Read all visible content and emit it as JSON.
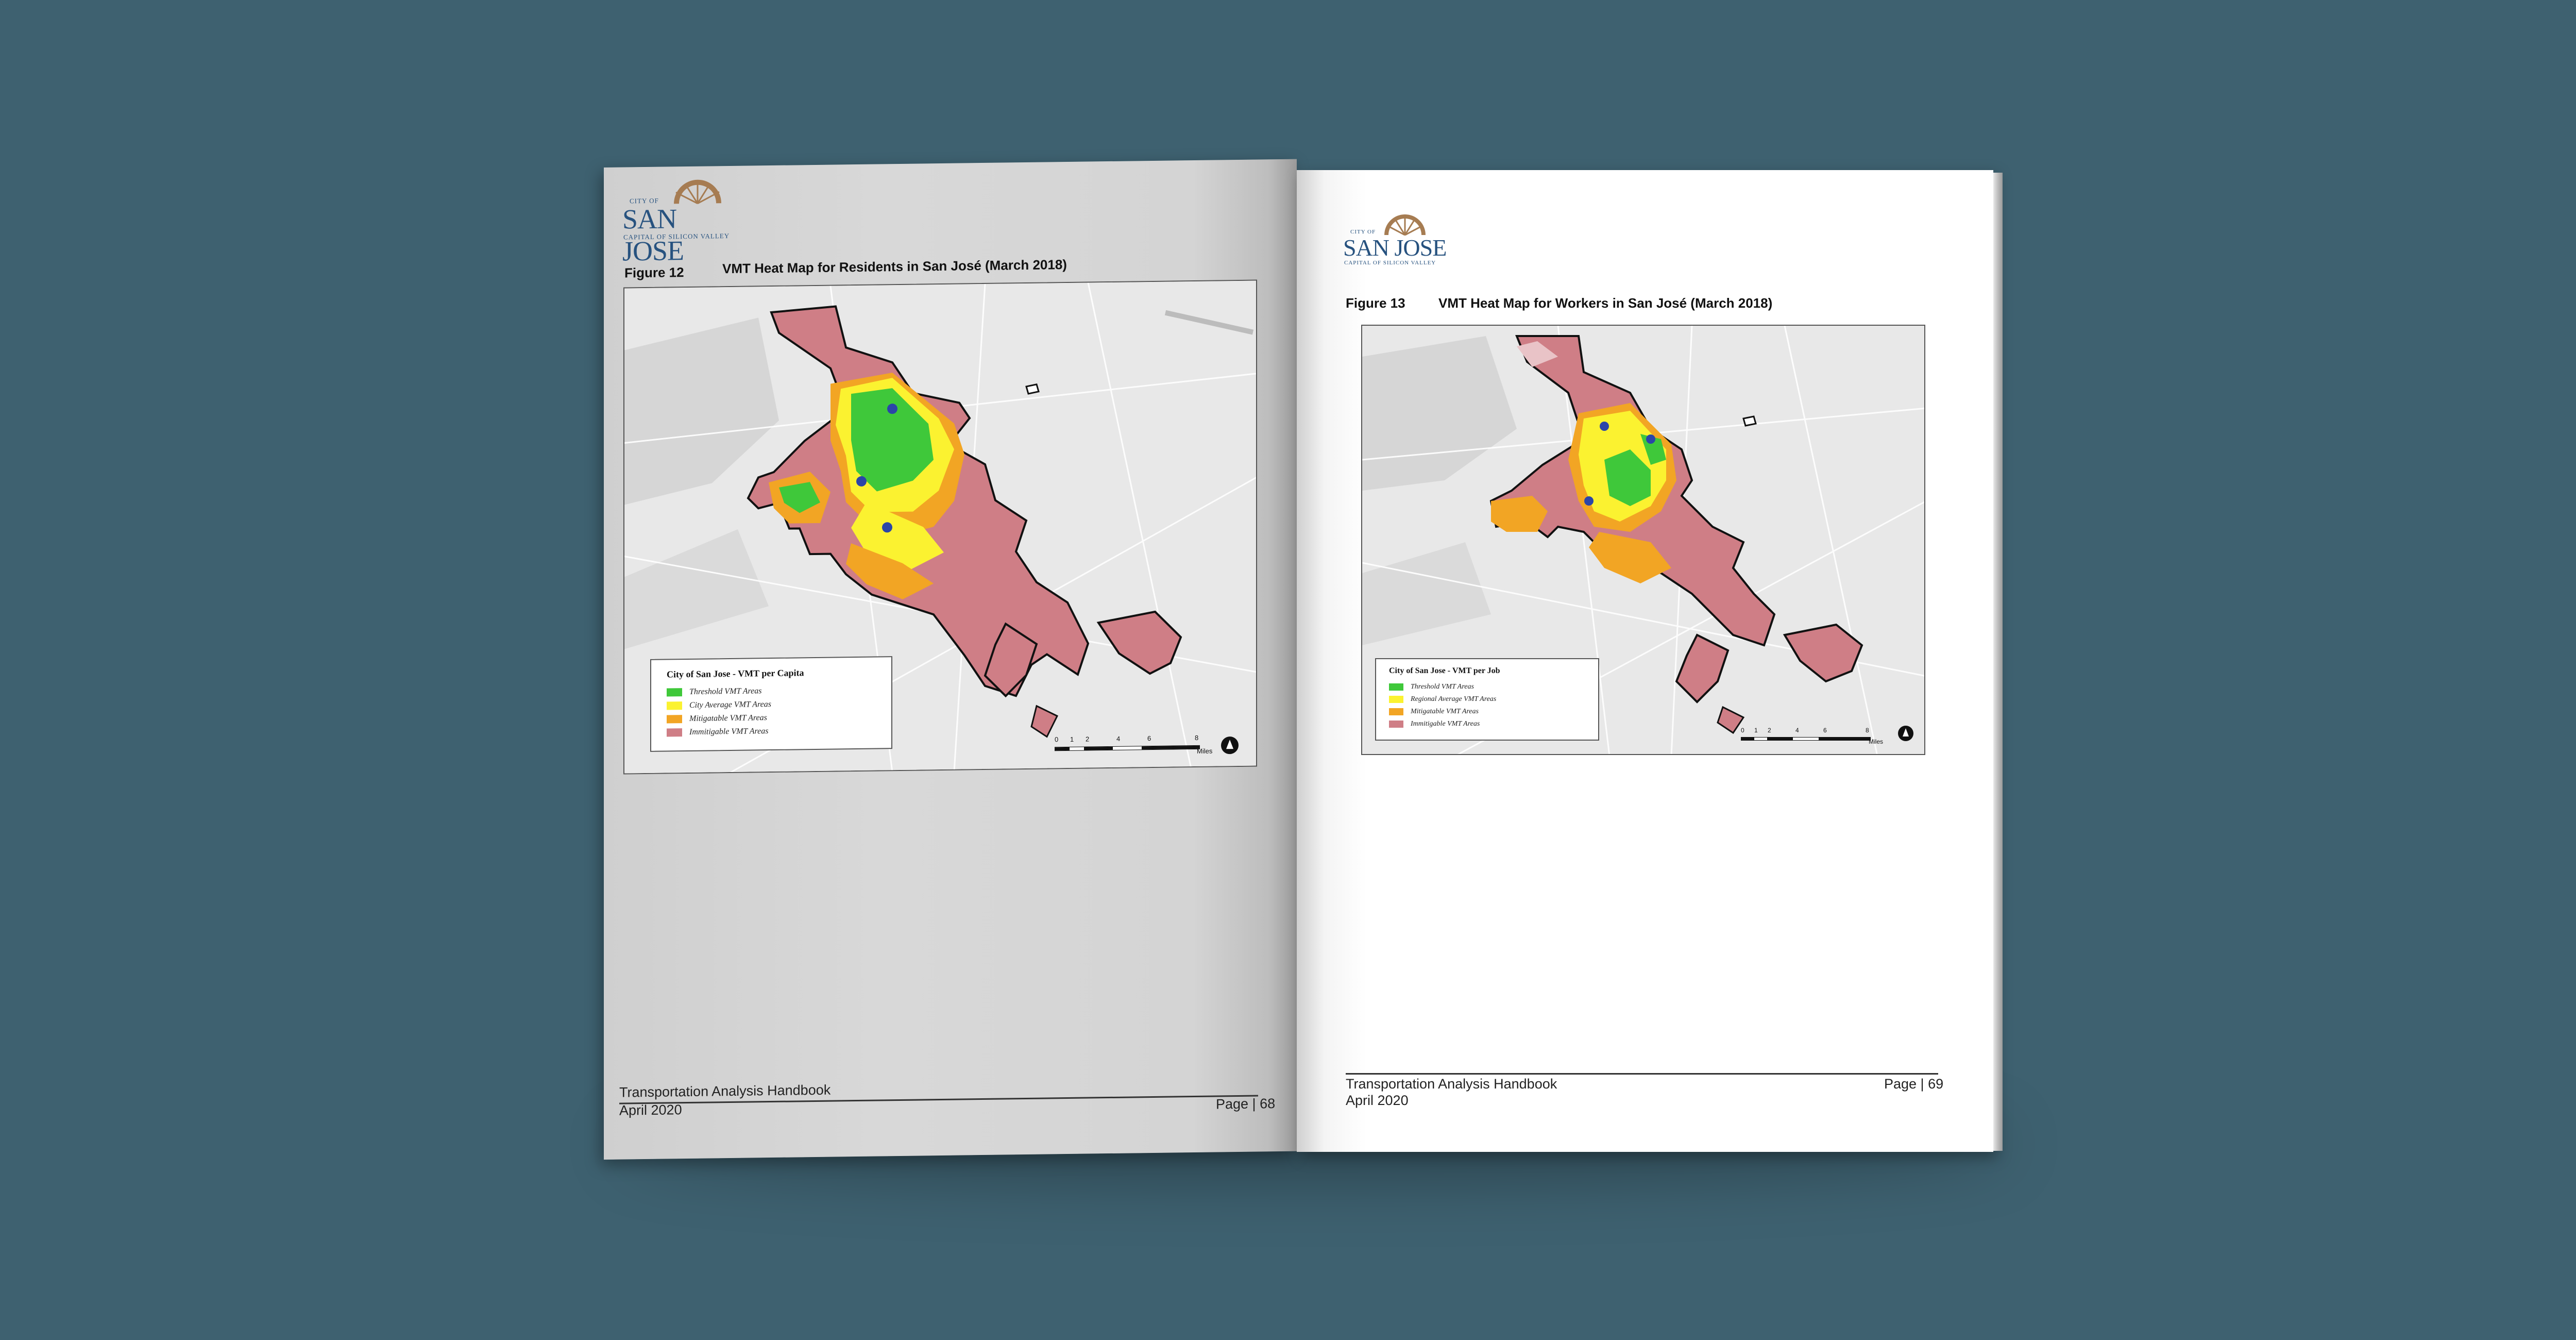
{
  "colors": {
    "background": "#3e6170",
    "threshold": "#3fc83a",
    "average": "#fbf230",
    "mitigatable": "#f2a524",
    "immitigable": "#cf7e86",
    "logo_blue": "#27527f",
    "logo_sun": "#a67c52"
  },
  "left_page": {
    "logo": {
      "city_of": "CITY OF",
      "name": "SAN JOSE",
      "tagline": "CAPITAL OF SILICON VALLEY"
    },
    "figure_label": "Figure 12",
    "figure_title": "VMT Heat Map for Residents in San José (March 2018)",
    "legend": {
      "title": "City of San Jose - VMT per Capita",
      "items": [
        "Threshold VMT Areas",
        "City Average VMT Areas",
        "Mitigatable VMT Areas",
        "Immitigable VMT Areas"
      ]
    },
    "scale": {
      "ticks": [
        "0",
        "1",
        "2",
        "4",
        "6",
        "8"
      ],
      "unit": "Miles"
    },
    "footer": {
      "title": "Transportation Analysis Handbook",
      "date": "April 2020",
      "page": "Page | 68"
    }
  },
  "right_page": {
    "logo": {
      "city_of": "CITY OF",
      "name": "SAN JOSE",
      "tagline": "CAPITAL OF SILICON VALLEY"
    },
    "figure_label": "Figure 13",
    "figure_title": "VMT Heat Map for Workers in San José (March 2018)",
    "legend": {
      "title": "City of San Jose - VMT per Job",
      "items": [
        "Threshold VMT Areas",
        "Regional Average VMT Areas",
        "Mitigatable VMT Areas",
        "Immitigable VMT Areas"
      ]
    },
    "scale": {
      "ticks": [
        "0",
        "1",
        "2",
        "4",
        "6",
        "8"
      ],
      "unit": "Miles"
    },
    "footer": {
      "title": "Transportation Analysis Handbook",
      "date": "April 2020",
      "page": "Page | 69"
    }
  }
}
